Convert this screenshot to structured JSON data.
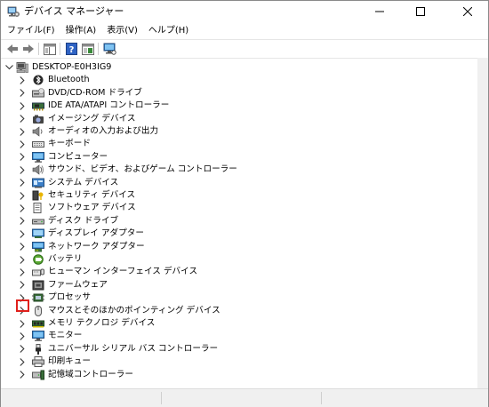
{
  "window": {
    "title": "デバイス マネージャー"
  },
  "menu": [
    {
      "label": "ファイル(F)",
      "name": "menu-file"
    },
    {
      "label": "操作(A)",
      "name": "menu-action"
    },
    {
      "label": "表示(V)",
      "name": "menu-view"
    },
    {
      "label": "ヘルプ(H)",
      "name": "menu-help"
    }
  ],
  "toolbar": {
    "buttons": [
      {
        "name": "back-button",
        "icon": "back-arrow-icon"
      },
      {
        "name": "forward-button",
        "icon": "forward-arrow-icon"
      },
      {
        "name": "show-hide-console-tree-button",
        "icon": "console-tree-icon"
      },
      {
        "name": "help-button",
        "icon": "help-icon"
      },
      {
        "name": "properties-button",
        "icon": "properties-icon"
      },
      {
        "name": "scan-hardware-button",
        "icon": "monitor-scan-icon"
      }
    ]
  },
  "tree": {
    "root": "DESKTOP-E0H3IG9",
    "items": [
      {
        "label": "Bluetooth",
        "icon": "bluetooth-icon"
      },
      {
        "label": "DVD/CD-ROM ドライブ",
        "icon": "dvd-drive-icon"
      },
      {
        "label": "IDE ATA/ATAPI コントローラー",
        "icon": "ide-controller-icon"
      },
      {
        "label": "イメージング デバイス",
        "icon": "camera-icon"
      },
      {
        "label": "オーディオの入力および出力",
        "icon": "speaker-icon"
      },
      {
        "label": "キーボード",
        "icon": "keyboard-icon"
      },
      {
        "label": "コンピューター",
        "icon": "computer-icon"
      },
      {
        "label": "サウンド、ビデオ、およびゲーム コントローラー",
        "icon": "sound-icon"
      },
      {
        "label": "システム デバイス",
        "icon": "system-device-icon"
      },
      {
        "label": "セキュリティ デバイス",
        "icon": "security-key-icon"
      },
      {
        "label": "ソフトウェア デバイス",
        "icon": "software-device-icon"
      },
      {
        "label": "ディスク ドライブ",
        "icon": "disk-drive-icon"
      },
      {
        "label": "ディスプレイ アダプター",
        "icon": "display-adapter-icon"
      },
      {
        "label": "ネットワーク アダプター",
        "icon": "network-adapter-icon"
      },
      {
        "label": "バッテリ",
        "icon": "battery-icon"
      },
      {
        "label": "ヒューマン インターフェイス デバイス",
        "icon": "hid-icon"
      },
      {
        "label": "ファームウェア",
        "icon": "firmware-icon"
      },
      {
        "label": "プロセッサ",
        "icon": "processor-icon"
      },
      {
        "label": "マウスとそのほかのポインティング デバイス",
        "icon": "mouse-icon"
      },
      {
        "label": "メモリ テクノロジ デバイス",
        "icon": "memory-icon"
      },
      {
        "label": "モニター",
        "icon": "monitor-icon"
      },
      {
        "label": "ユニバーサル シリアル バス コントローラー",
        "icon": "usb-icon"
      },
      {
        "label": "印刷キュー",
        "icon": "printer-icon"
      },
      {
        "label": "記憶域コントローラー",
        "icon": "storage-controller-icon"
      }
    ],
    "highlighted_item": "ネットワーク アダプター",
    "highlight_color": "#e0201c"
  }
}
